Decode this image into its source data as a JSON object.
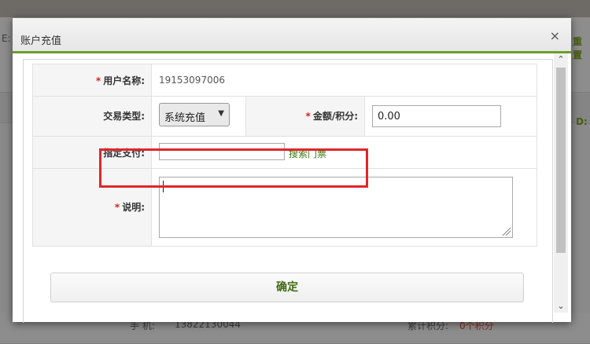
{
  "background": {
    "top_right_link": "重置",
    "bottom_phone_label": "手  机:",
    "bottom_phone_value": "13822130044",
    "bottom_points_label": "累计积分:",
    "bottom_points_value": "0个积分",
    "left_fragment": "E:",
    "right_fragment": "D:"
  },
  "dialog": {
    "title": "账户充值",
    "close_label": "×"
  },
  "form": {
    "username_label": "用户名称:",
    "username_value": "19153097006",
    "trade_type_label": "交易类型:",
    "trade_type_value": "系统充值",
    "amount_label": "金额/积分:",
    "amount_value": "0.00",
    "payment_label": "指定支付:",
    "payment_value": "",
    "search_ticket_link": "搜索门票",
    "note_label": "说明:",
    "note_value": "",
    "required_mark": "*",
    "confirm_button": "确定"
  },
  "scrollbar": {
    "up": "⌃",
    "down": "⌄"
  }
}
